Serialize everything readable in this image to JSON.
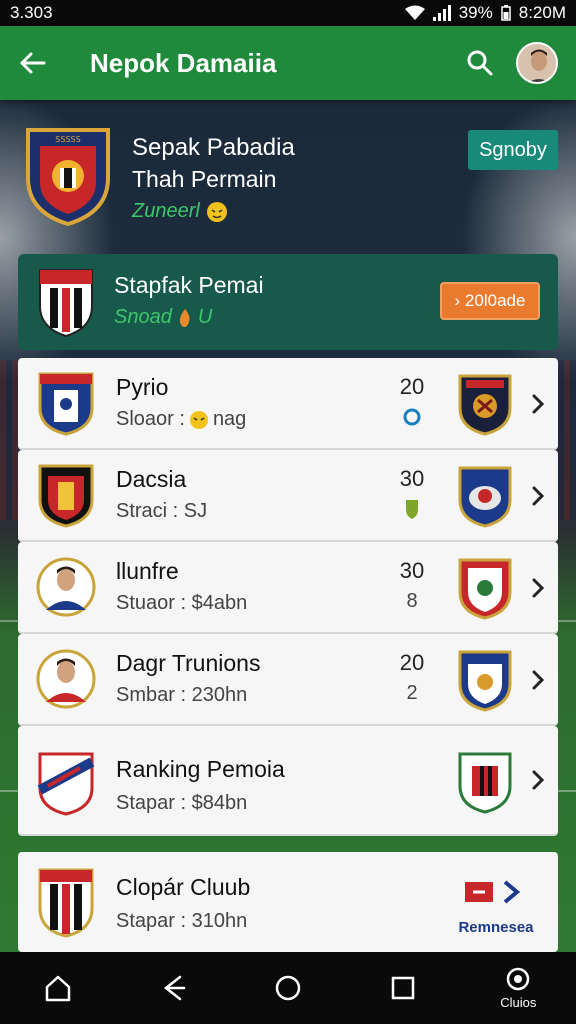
{
  "status_bar": {
    "time_left": "3.303",
    "battery": "39%",
    "time_right": "8:20M"
  },
  "app_bar": {
    "title": "Nepok Damaiia"
  },
  "header": {
    "team_name": "Sepak Pabadia",
    "subtitle": "Thah Permain",
    "status": "Zuneerl",
    "sponsor_button": "Sgnoby"
  },
  "featured": {
    "name": "Stapfak Pemai",
    "status": "Snoad",
    "status_num": "U",
    "button": "› 20l0ade"
  },
  "rows": [
    {
      "name": "Pyrio",
      "meta_label": "Sloaor :",
      "meta_value": "nag",
      "score": "20",
      "score2": "0"
    },
    {
      "name": "Dacsia",
      "meta_label": "Straci : SJ",
      "meta_value": "",
      "score": "30",
      "score2": ""
    },
    {
      "name": "llunfre",
      "meta_label": "Stuaor : $4abn",
      "meta_value": "",
      "score": "30",
      "score2": "8"
    },
    {
      "name": "Dagr Trunions",
      "meta_label": "Smbar : 230hn",
      "meta_value": "",
      "score": "20",
      "score2": "2"
    },
    {
      "name": "Ranking Pemoia",
      "meta_label": "Stapar : $84bn",
      "meta_value": "",
      "score": "",
      "score2": ""
    }
  ],
  "last_card": {
    "name": "Clopár Cluub",
    "meta": "Stapar : 310hn",
    "brand": "Remnesea"
  },
  "nav": {
    "clubs_label": "Cluios"
  },
  "icons": [
    "back-arrow-icon",
    "search-icon",
    "chevron-right-icon",
    "home-icon",
    "back-icon",
    "circle-home-icon",
    "square-recents-icon",
    "clubs-icon"
  ],
  "colors": {
    "app_bar": "#1f8a3c",
    "accent_green": "#3cc76a",
    "sponsor_btn": "#178a7a",
    "orange_btn": "#ea7a2e",
    "featured_card": "#17594a"
  }
}
